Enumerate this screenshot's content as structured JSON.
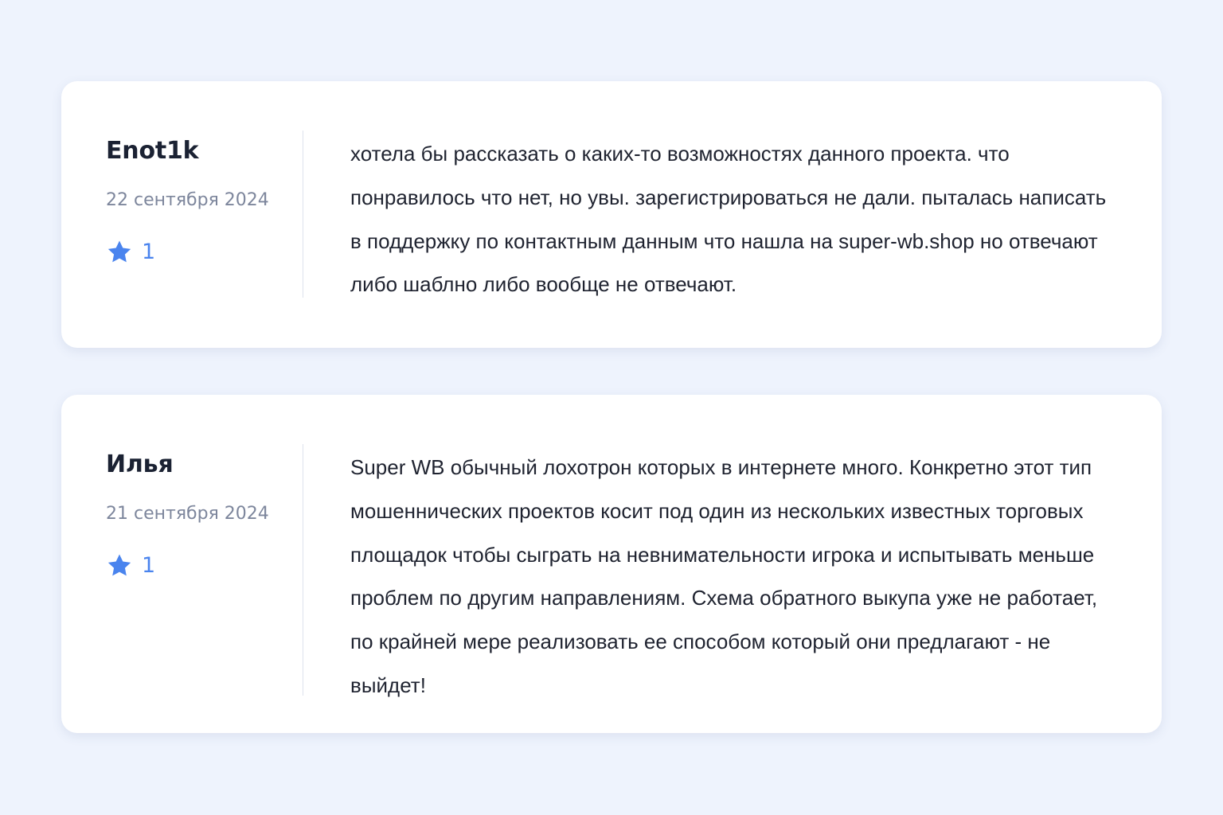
{
  "colors": {
    "background": "#eef3fd",
    "card": "#ffffff",
    "author": "#1b2233",
    "date": "#7d869c",
    "rating_accent": "#4a84ee",
    "body_text": "#1f2330"
  },
  "reviews": [
    {
      "author": "Enot1k",
      "date": "22 сентября 2024",
      "rating_icon": "star-icon",
      "rating": "1",
      "text": "хотела бы рассказать о каких-то возможностях данного проекта. что понравилось что нет, но увы. зарегистрироваться не дали. пыталась написать в поддержку по контактным данным что нашла на super-wb.shop но отвечают либо шаблно либо вообще не отвечают."
    },
    {
      "author": "Илья",
      "date": "21 сентября 2024",
      "rating_icon": "star-icon",
      "rating": "1",
      "text": "Super WB обычный лохотрон которых в интернете много. Конкретно этот тип мошеннических проектов косит под один из нескольких известных торговых площадок чтобы сыграть на невнимательности игрока и испытывать меньше проблем по другим направлениям. Схема обратного выкупа уже не работает, по крайней мере реализовать ее способом который они предлагают - не выйдет!"
    }
  ]
}
